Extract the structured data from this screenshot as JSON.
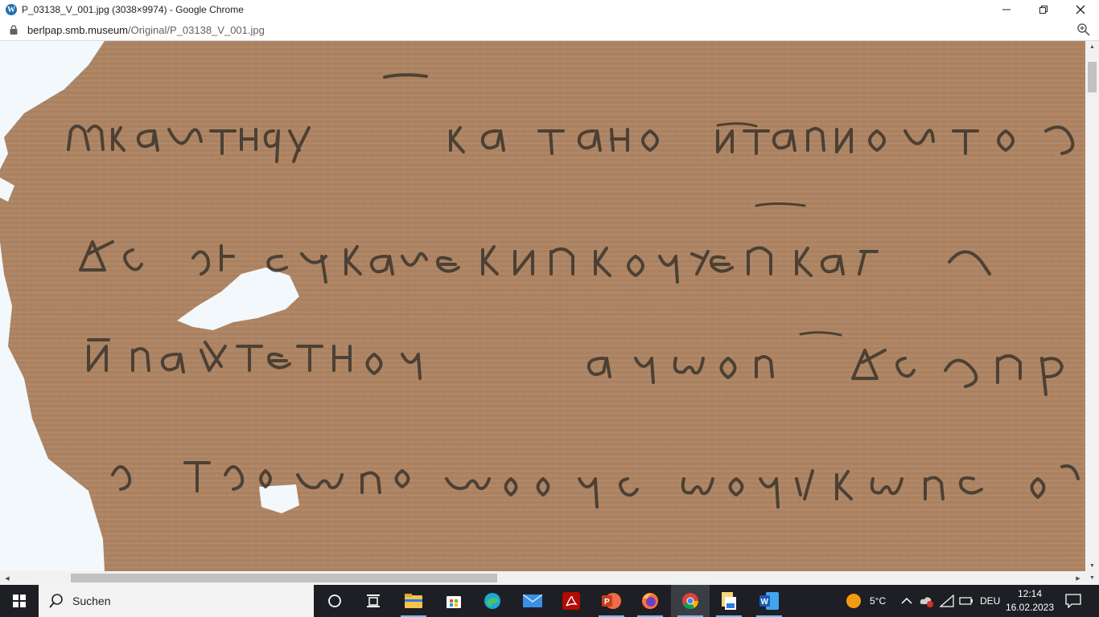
{
  "window": {
    "title": "P_03138_V_001.jpg (3038×9974) - Google Chrome",
    "favicon_letter": "W"
  },
  "address": {
    "host": "berlpap.smb.museum",
    "path": "/Original/P_03138_V_001.jpg"
  },
  "taskbar": {
    "search_label": "Suchen",
    "weather_temp": "5°C",
    "language": "DEU",
    "time": "12:14",
    "date": "16.02.2023",
    "apps": [
      {
        "name": "task-view-icon"
      },
      {
        "name": "widgets-icon"
      },
      {
        "name": "file-explorer-icon"
      },
      {
        "name": "store-icon"
      },
      {
        "name": "edge-icon"
      },
      {
        "name": "mail-icon"
      },
      {
        "name": "acrobat-icon"
      },
      {
        "name": "powerpoint-icon"
      },
      {
        "name": "firefox-icon"
      },
      {
        "name": "chrome-icon"
      },
      {
        "name": "file-manager-icon"
      },
      {
        "name": "word-icon"
      }
    ]
  },
  "colors": {
    "papyrus": "#ad8463",
    "ink": "#3c352c",
    "background": "#f2f8fb",
    "taskbar": "#1d1f24"
  }
}
